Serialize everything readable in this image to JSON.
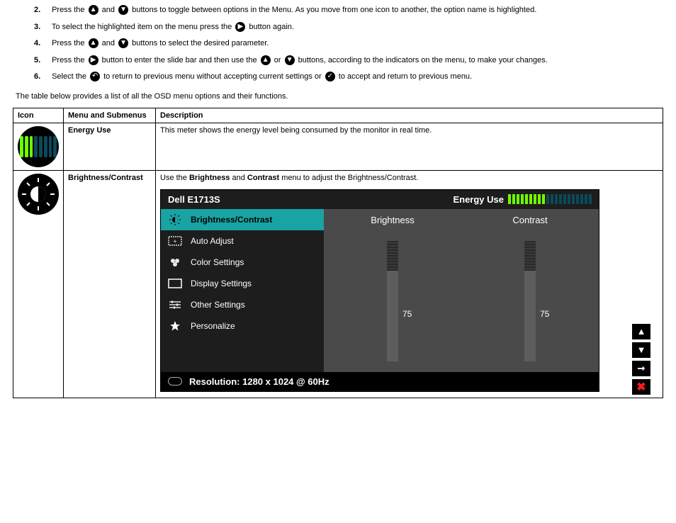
{
  "steps": [
    {
      "n": "2.",
      "pre": "Press the ",
      "mid": " and ",
      "post": " buttons to toggle between options in the Menu. As you move from one icon to another, the option name is highlighted."
    },
    {
      "n": "3.",
      "pre": "To select the highlighted item on the menu press the ",
      "post": " button again."
    },
    {
      "n": "4.",
      "pre": "Press the ",
      "mid": " and ",
      "post": " buttons to select the desired parameter."
    },
    {
      "n": "5.",
      "pre": "Press the ",
      "mid1": " button to enter the slide bar and then use the ",
      "or": " or ",
      "post": " buttons, according to the indicators on the menu, to make your changes."
    },
    {
      "n": "6.",
      "pre": "Select the ",
      "mid1": " to return to previous menu without accepting current settings or ",
      "post": " to accept and return to previous menu."
    }
  ],
  "intro": "The table below provides a list of all the OSD menu options and their functions.",
  "headers": {
    "icon": "Icon",
    "menu": "Menu and Submenus",
    "desc": "Description"
  },
  "rows": {
    "energy": {
      "menu": "Energy Use",
      "desc": "This meter shows the energy level being consumed by the monitor in real time."
    },
    "bc": {
      "menu": "Brightness/Contrast",
      "desc_pre": "Use the ",
      "desc_b1": "Brightness",
      "desc_and": " and ",
      "desc_b2": "Contrast",
      "desc_post": " menu to adjust the Brightness/Contrast."
    }
  },
  "osd": {
    "title": "Dell E1713S",
    "eu_label": "Energy Use",
    "menu_items": [
      {
        "label": "Brightness/Contrast",
        "active": true
      },
      {
        "label": "Auto Adjust",
        "active": false
      },
      {
        "label": "Color Settings",
        "active": false
      },
      {
        "label": "Display Settings",
        "active": false
      },
      {
        "label": "Other Settings",
        "active": false
      },
      {
        "label": "Personalize",
        "active": false
      }
    ],
    "sliders": {
      "brightness": {
        "label": "Brightness",
        "value": "75"
      },
      "contrast": {
        "label": "Contrast",
        "value": "75"
      }
    },
    "resolution": "Resolution: 1280 x 1024 @ 60Hz"
  },
  "eu_colors": [
    "#6fff00",
    "#6fff00",
    "#6fff00",
    "#6fff00",
    "#6fff00",
    "#6fff00",
    "#6fff00",
    "#6fff00",
    "#6fff00",
    "#0a4a5a",
    "#0a4a5a",
    "#0a4a5a",
    "#0a4a5a",
    "#0a4a5a",
    "#0a4a5a",
    "#0a4a5a",
    "#0a4a5a",
    "#0a4a5a",
    "#0a4a5a",
    "#0a4a5a"
  ],
  "icon_bar_colors": [
    "#6fff00",
    "#6fff00",
    "#6fff00",
    "#0a4a5a",
    "#0a4a5a",
    "#0a4a5a",
    "#0a4a5a",
    "#0a4a5a"
  ]
}
